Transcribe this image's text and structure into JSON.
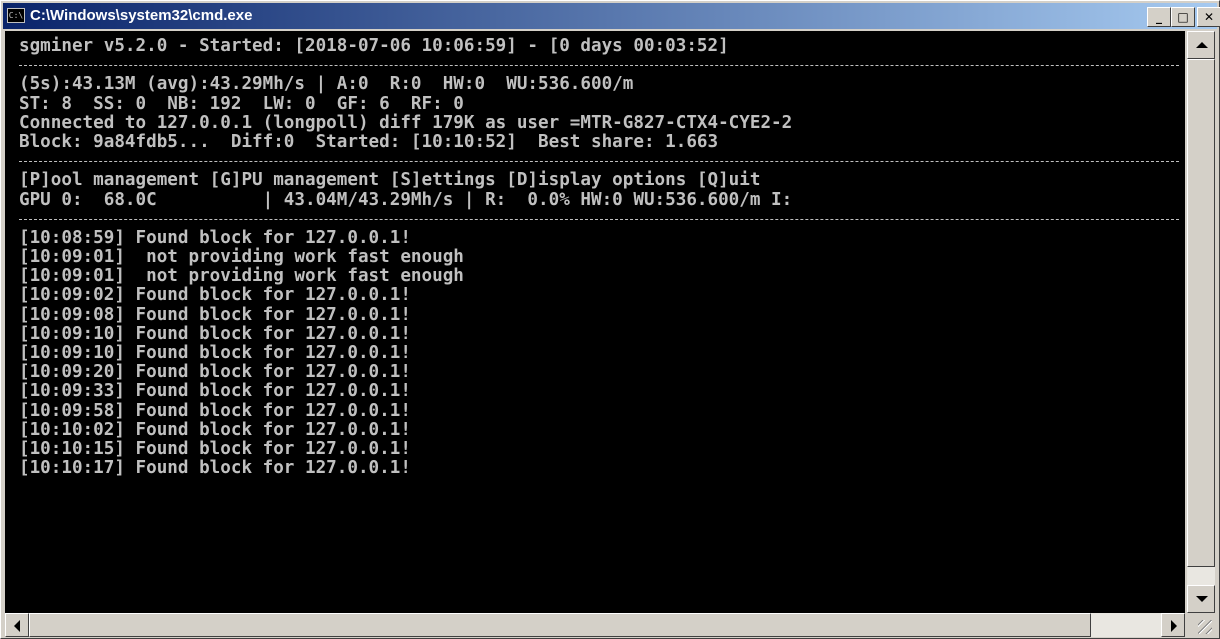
{
  "window": {
    "title": "C:\\Windows\\system32\\cmd.exe",
    "icon_label": "C:\\",
    "controls": {
      "minimize": "_",
      "maximize": "□",
      "close": "✕"
    }
  },
  "console": {
    "header": "sgminer v5.2.0 - Started: [2018-07-06 10:06:59] - [0 days 00:03:52]",
    "status_lines": [
      "(5s):43.13M (avg):43.29Mh/s | A:0  R:0  HW:0  WU:536.600/m",
      "ST: 8  SS: 0  NB: 192  LW: 0  GF: 6  RF: 0",
      "Connected to 127.0.0.1 (longpoll) diff 179K as user =MTR-G827-CTX4-CYE2-2",
      "Block: 9a84fdb5...  Diff:0  Started: [10:10:52]  Best share: 1.663"
    ],
    "menu_line": "[P]ool management [G]PU management [S]ettings [D]isplay options [Q]uit",
    "gpu_line": "GPU 0:  68.0C          | 43.04M/43.29Mh/s | R:  0.0% HW:0 WU:536.600/m I:",
    "log": [
      "[10:08:59] Found block for 127.0.0.1!",
      "[10:09:01]  not providing work fast enough",
      "[10:09:01]  not providing work fast enough",
      "[10:09:02] Found block for 127.0.0.1!",
      "[10:09:08] Found block for 127.0.0.1!",
      "[10:09:10] Found block for 127.0.0.1!",
      "[10:09:10] Found block for 127.0.0.1!",
      "[10:09:20] Found block for 127.0.0.1!",
      "[10:09:33] Found block for 127.0.0.1!",
      "[10:09:58] Found block for 127.0.0.1!",
      "[10:10:02] Found block for 127.0.0.1!",
      "[10:10:15] Found block for 127.0.0.1!",
      "[10:10:17] Found block for 127.0.0.1!"
    ]
  },
  "colors": {
    "console_bg": "#000000",
    "console_fg": "#c0c0c0",
    "titlebar": "#0a246a"
  }
}
